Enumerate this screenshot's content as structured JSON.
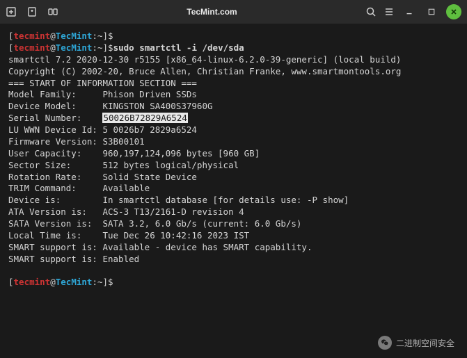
{
  "titlebar": {
    "title": "TecMint.com"
  },
  "prompt": {
    "user": "tecmint",
    "host": "TecMint",
    "path": "~",
    "bracket_open": "[",
    "bracket_close": "]",
    "at": "@",
    "colon_path": ":",
    "dollar": "$"
  },
  "command": "sudo smartctl -i /dev/sda",
  "output": {
    "version": "smartctl 7.2 2020-12-30 r5155 [x86_64-linux-6.2.0-39-generic] (local build)",
    "copyright": "Copyright (C) 2002-20, Bruce Allen, Christian Franke, www.smartmontools.org",
    "blank1": "",
    "section": "=== START OF INFORMATION SECTION ===",
    "model_family": "Model Family:     Phison Driven SSDs",
    "device_model": "Device Model:     KINGSTON SA400S37960G",
    "serial_label": "Serial Number:    ",
    "serial_value": "50026B72829A6524",
    "lu_wwn": "LU WWN Device Id: 5 0026b7 2829a6524",
    "firmware": "Firmware Version: S3B00101",
    "user_capacity": "User Capacity:    960,197,124,096 bytes [960 GB]",
    "sector_size": "Sector Size:      512 bytes logical/physical",
    "rotation_rate": "Rotation Rate:    Solid State Device",
    "trim": "TRIM Command:     Available",
    "device_is": "Device is:        In smartctl database [for details use: -P show]",
    "ata_version": "ATA Version is:   ACS-3 T13/2161-D revision 4",
    "sata_version": "SATA Version is:  SATA 3.2, 6.0 Gb/s (current: 6.0 Gb/s)",
    "local_time": "Local Time is:    Tue Dec 26 10:42:16 2023 IST",
    "smart_support_1": "SMART support is: Available - device has SMART capability.",
    "smart_support_2": "SMART support is: Enabled"
  },
  "watermark": "二进制空间安全"
}
